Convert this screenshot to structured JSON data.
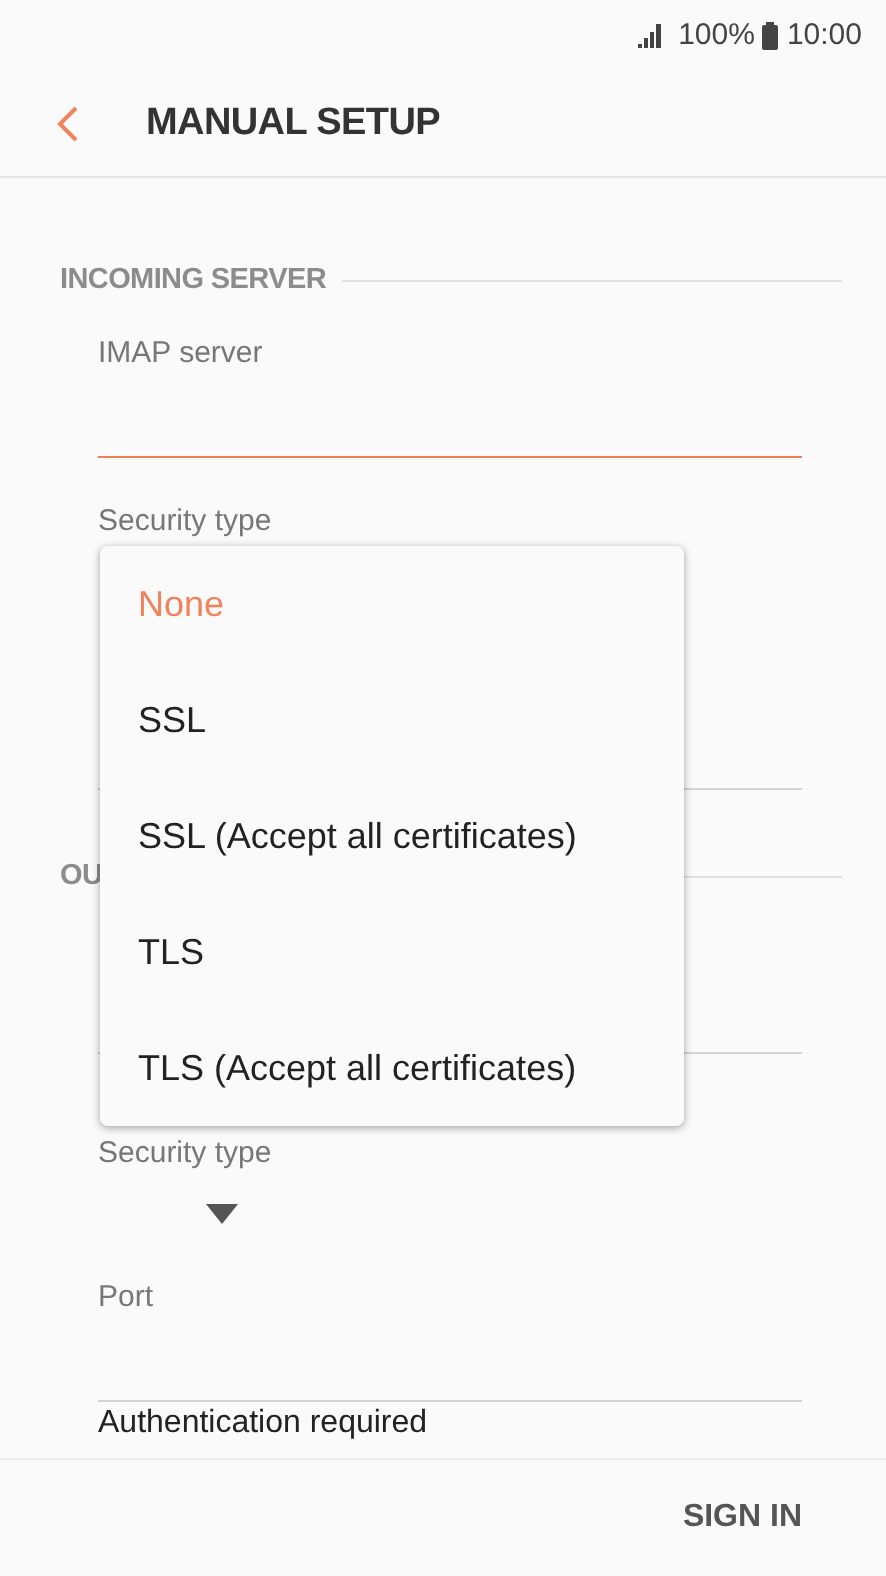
{
  "status_bar": {
    "battery": "100%",
    "time": "10:00"
  },
  "header": {
    "title": "MANUAL SETUP"
  },
  "sections": [
    {
      "heading": "INCOMING SERVER",
      "items": [
        {
          "kind": "field",
          "label": "IMAP server",
          "focused": true
        },
        {
          "kind": "select",
          "label": "Security type"
        },
        {
          "kind": "field",
          "focused": false
        }
      ]
    },
    {
      "heading": "OU",
      "items": [
        {
          "kind": "field",
          "focused": false
        },
        {
          "kind": "select",
          "label": "Security type",
          "expanded": false
        },
        {
          "kind": "field",
          "label": "Port",
          "focused": false
        },
        {
          "kind": "text",
          "label": "Authentication required"
        }
      ]
    }
  ],
  "menu": {
    "options": [
      {
        "label": "None",
        "selected": true
      },
      {
        "label": "SSL",
        "selected": false
      },
      {
        "label": "SSL (Accept all certificates)",
        "selected": false
      },
      {
        "label": "TLS",
        "selected": false
      },
      {
        "label": "TLS (Accept all certificates)",
        "selected": false
      }
    ]
  },
  "footer": {
    "button": "SIGN IN"
  }
}
